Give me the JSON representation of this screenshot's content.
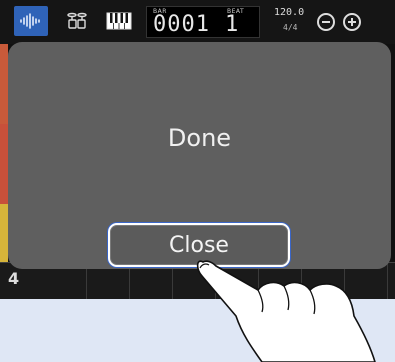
{
  "toolbar": {
    "icons": [
      "waveform-icon",
      "drum-kit-icon",
      "piano-keys-icon"
    ],
    "counter": {
      "bar_label": "BAR",
      "bar_value": "0001",
      "beat_label": "BEAT",
      "beat_value": "1"
    },
    "tempo": {
      "bpm": "120.0",
      "time_signature": "4/4"
    },
    "buttons": [
      "zoom-out",
      "zoom-in"
    ]
  },
  "track": {
    "number": "4",
    "accent_colors": [
      "#c85a3a",
      "#c8503a",
      "#d6b43a",
      "#e6e24a"
    ]
  },
  "dialog": {
    "message": "Done",
    "close_label": "Close"
  },
  "colors": {
    "accent": "#2f63b8",
    "dialog_bg": "#5f5f5f",
    "page_bg": "#dfe7f5"
  }
}
